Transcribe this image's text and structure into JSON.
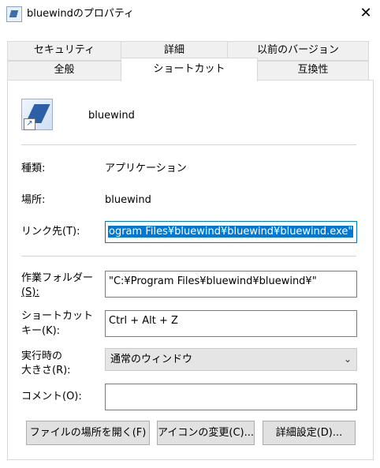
{
  "window": {
    "title": "bluewindのプロパティ",
    "close_symbol": "✕"
  },
  "tabs_row1": [
    "セキュリティ",
    "詳細",
    "以前のバージョン"
  ],
  "tabs_row2": [
    "全般",
    "ショートカット",
    "互換性"
  ],
  "active_tab": "ショートカット",
  "shortcut": {
    "name": "bluewind",
    "type_label": "種類:",
    "type_value": "アプリケーション",
    "location_label": "場所:",
    "location_value": "bluewind",
    "target_label": "リンク先(T):",
    "target_value": "ogram Files¥bluewind¥bluewind¥bluewind.exe\"",
    "startin_label_1": "作業フォルダー",
    "startin_label_2": "(S):",
    "startin_value": "\"C:¥Program Files¥bluewind¥bluewind¥\"",
    "hotkey_label_1": "ショートカット",
    "hotkey_label_2": "キー(K):",
    "hotkey_value": "Ctrl + Alt + Z",
    "run_label_1": "実行時の",
    "run_label_2": "大きさ(R):",
    "run_value": "通常のウィンドウ",
    "comment_label": "コメント(O):",
    "comment_value": ""
  },
  "buttons": {
    "open_location": "ファイルの場所を開く(F)",
    "change_icon": "アイコンの変更(C)...",
    "advanced": "詳細設定(D)..."
  },
  "colors": {
    "selection": "#0078d7",
    "tab_bg": "#f0f0f0",
    "button_bg": "#e1e1e1"
  }
}
